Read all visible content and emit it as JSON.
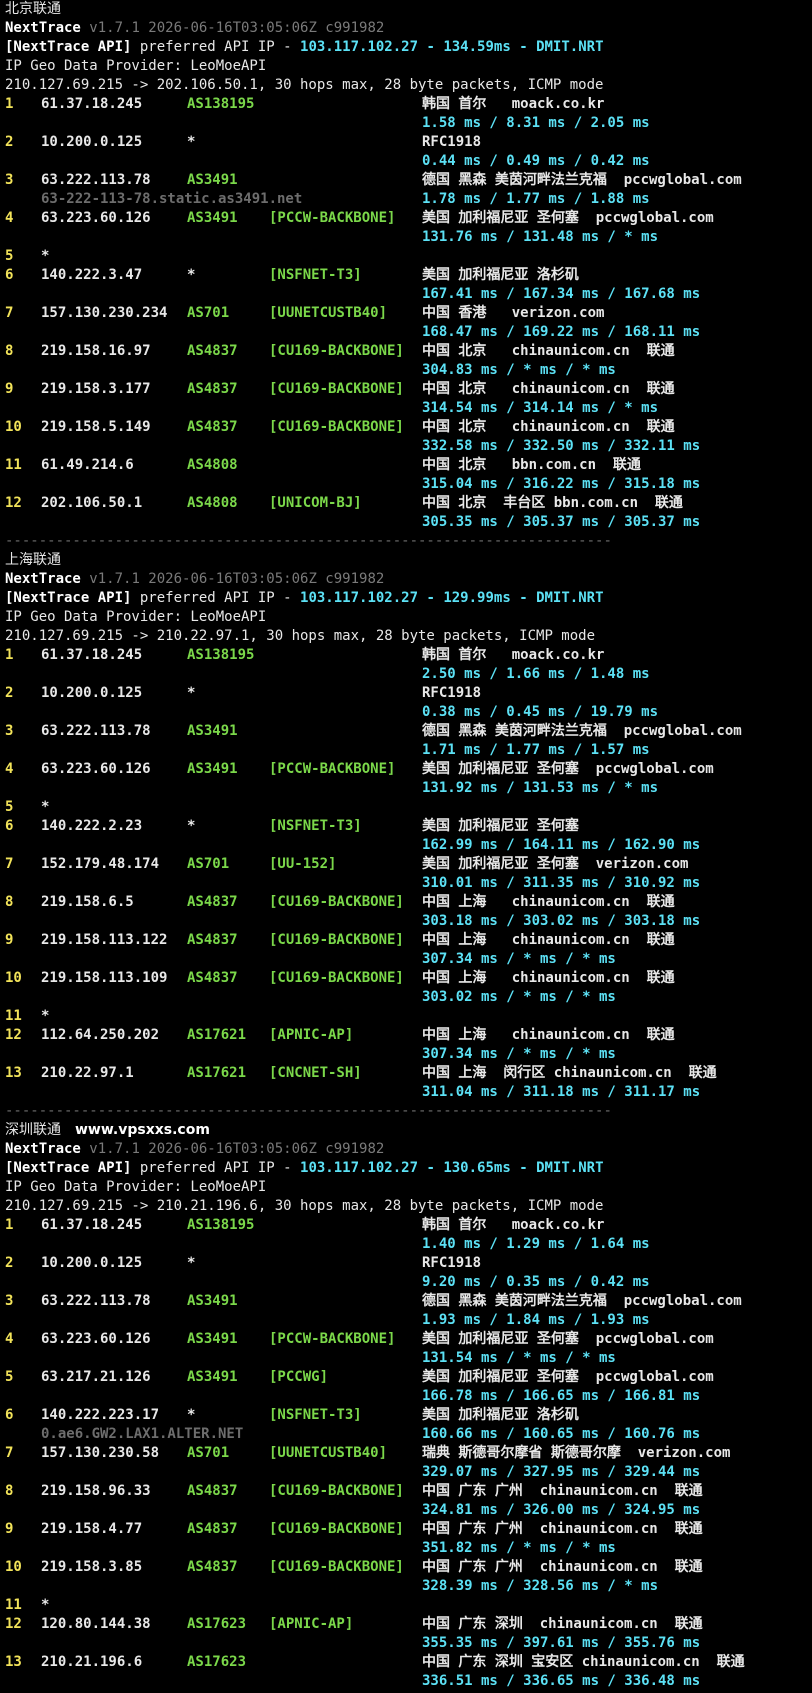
{
  "sections": [
    {
      "title": "北京联通",
      "site": "",
      "product": "NextTrace",
      "version": "v1.7.1 2026-06-16T03:05:06Z c991982",
      "api_prefix": "[NextTrace API]",
      "api_text": " preferred API IP - ",
      "api_ip": "103.117.102.27",
      "api_dash": " - ",
      "api_latency": "134.59ms",
      "api_node": "DMIT.NRT",
      "geo_provider": "IP Geo Data Provider: LeoMoeAPI",
      "trace_line": "210.127.69.215 -> 202.106.50.1, 30 hops max, 28 byte packets, ICMP mode",
      "hops": [
        {
          "n": "1",
          "ip": "61.37.18.245",
          "as": "AS138195",
          "net": "",
          "geo": "韩国 首尔   moack.co.kr",
          "rtt": "1.58 ms / 8.31 ms / 2.05 ms"
        },
        {
          "n": "2",
          "ip": "10.200.0.125",
          "as": "*",
          "net": "",
          "geo": "RFC1918",
          "rtt": "0.44 ms / 0.49 ms / 0.42 ms"
        },
        {
          "n": "3",
          "ip": "63.222.113.78",
          "as": "AS3491",
          "net": "",
          "geo": "德国 黑森 美茵河畔法兰克福  pccwglobal.com",
          "ptr": "63-222-113-78.static.as3491.net",
          "rtt": "1.78 ms / 1.77 ms / 1.88 ms"
        },
        {
          "n": "4",
          "ip": "63.223.60.126",
          "as": "AS3491",
          "net": "[PCCW-BACKBONE]",
          "geo": "美国 加利福尼亚 圣何塞  pccwglobal.com",
          "rtt": "131.76 ms / 131.48 ms / * ms"
        },
        {
          "n": "5",
          "ip": "*"
        },
        {
          "n": "6",
          "ip": "140.222.3.47",
          "as": "*",
          "net": "[NSFNET-T3]",
          "geo": "美国 加利福尼亚 洛杉矶",
          "rtt": "167.41 ms / 167.34 ms / 167.68 ms"
        },
        {
          "n": "7",
          "ip": "157.130.230.234",
          "as": "AS701",
          "net": "[UUNETCUSTB40]",
          "geo": "中国 香港   verizon.com",
          "rtt": "168.47 ms / 169.22 ms / 168.11 ms"
        },
        {
          "n": "8",
          "ip": "219.158.16.97",
          "as": "AS4837",
          "net": "[CU169-BACKBONE]",
          "geo": "中国 北京   chinaunicom.cn  联通",
          "rtt": "304.83 ms / * ms / * ms"
        },
        {
          "n": "9",
          "ip": "219.158.3.177",
          "as": "AS4837",
          "net": "[CU169-BACKBONE]",
          "geo": "中国 北京   chinaunicom.cn  联通",
          "rtt": "314.54 ms / 314.14 ms / * ms"
        },
        {
          "n": "10",
          "ip": "219.158.5.149",
          "as": "AS4837",
          "net": "[CU169-BACKBONE]",
          "geo": "中国 北京   chinaunicom.cn  联通",
          "rtt": "332.58 ms / 332.50 ms / 332.11 ms"
        },
        {
          "n": "11",
          "ip": "61.49.214.6",
          "as": "AS4808",
          "net": "",
          "geo": "中国 北京   bbn.com.cn  联通",
          "rtt": "315.04 ms / 316.22 ms / 315.18 ms"
        },
        {
          "n": "12",
          "ip": "202.106.50.1",
          "as": "AS4808",
          "net": "[UNICOM-BJ]",
          "geo": "中国 北京  丰台区 bbn.com.cn  联通",
          "rtt": "305.35 ms / 305.37 ms / 305.37 ms"
        }
      ]
    },
    {
      "title": "上海联通",
      "site": "",
      "product": "NextTrace",
      "version": "v1.7.1 2026-06-16T03:05:06Z c991982",
      "api_prefix": "[NextTrace API]",
      "api_text": " preferred API IP - ",
      "api_ip": "103.117.102.27",
      "api_dash": " - ",
      "api_latency": "129.99ms",
      "api_node": "DMIT.NRT",
      "geo_provider": "IP Geo Data Provider: LeoMoeAPI",
      "trace_line": "210.127.69.215 -> 210.22.97.1, 30 hops max, 28 byte packets, ICMP mode",
      "hops": [
        {
          "n": "1",
          "ip": "61.37.18.245",
          "as": "AS138195",
          "net": "",
          "geo": "韩国 首尔   moack.co.kr",
          "rtt": "2.50 ms / 1.66 ms / 1.48 ms"
        },
        {
          "n": "2",
          "ip": "10.200.0.125",
          "as": "*",
          "net": "",
          "geo": "RFC1918",
          "rtt": "0.38 ms / 0.45 ms / 19.79 ms"
        },
        {
          "n": "3",
          "ip": "63.222.113.78",
          "as": "AS3491",
          "net": "",
          "geo": "德国 黑森 美茵河畔法兰克福  pccwglobal.com",
          "rtt": "1.71 ms / 1.77 ms / 1.57 ms"
        },
        {
          "n": "4",
          "ip": "63.223.60.126",
          "as": "AS3491",
          "net": "[PCCW-BACKBONE]",
          "geo": "美国 加利福尼亚 圣何塞  pccwglobal.com",
          "rtt": "131.92 ms / 131.53 ms / * ms"
        },
        {
          "n": "5",
          "ip": "*"
        },
        {
          "n": "6",
          "ip": "140.222.2.23",
          "as": "*",
          "net": "[NSFNET-T3]",
          "geo": "美国 加利福尼亚 圣何塞",
          "rtt": "162.99 ms / 164.11 ms / 162.90 ms"
        },
        {
          "n": "7",
          "ip": "152.179.48.174",
          "as": "AS701",
          "net": "[UU-152]",
          "geo": "美国 加利福尼亚 圣何塞  verizon.com",
          "rtt": "310.01 ms / 311.35 ms / 310.92 ms"
        },
        {
          "n": "8",
          "ip": "219.158.6.5",
          "as": "AS4837",
          "net": "[CU169-BACKBONE]",
          "geo": "中国 上海   chinaunicom.cn  联通",
          "rtt": "303.18 ms / 303.02 ms / 303.18 ms"
        },
        {
          "n": "9",
          "ip": "219.158.113.122",
          "as": "AS4837",
          "net": "[CU169-BACKBONE]",
          "geo": "中国 上海   chinaunicom.cn  联通",
          "rtt": "307.34 ms / * ms / * ms"
        },
        {
          "n": "10",
          "ip": "219.158.113.109",
          "as": "AS4837",
          "net": "[CU169-BACKBONE]",
          "geo": "中国 上海   chinaunicom.cn  联通",
          "rtt": "303.02 ms / * ms / * ms"
        },
        {
          "n": "11",
          "ip": "*"
        },
        {
          "n": "12",
          "ip": "112.64.250.202",
          "as": "AS17621",
          "net": "[APNIC-AP]",
          "geo": "中国 上海   chinaunicom.cn  联通",
          "rtt": "307.34 ms / * ms / * ms"
        },
        {
          "n": "13",
          "ip": "210.22.97.1",
          "as": "AS17621",
          "net": "[CNCNET-SH]",
          "geo": "中国 上海  闵行区 chinaunicom.cn  联通",
          "rtt": "311.04 ms / 311.18 ms / 311.17 ms"
        }
      ]
    },
    {
      "title": "深圳联通",
      "site": "www.vpsxxs.com",
      "product": "NextTrace",
      "version": "v1.7.1 2026-06-16T03:05:06Z c991982",
      "api_prefix": "[NextTrace API]",
      "api_text": " preferred API IP - ",
      "api_ip": "103.117.102.27",
      "api_dash": " - ",
      "api_latency": "130.65ms",
      "api_node": "DMIT.NRT",
      "geo_provider": "IP Geo Data Provider: LeoMoeAPI",
      "trace_line": "210.127.69.215 -> 210.21.196.6, 30 hops max, 28 byte packets, ICMP mode",
      "hops": [
        {
          "n": "1",
          "ip": "61.37.18.245",
          "as": "AS138195",
          "net": "",
          "geo": "韩国 首尔   moack.co.kr",
          "rtt": "1.40 ms / 1.29 ms / 1.64 ms"
        },
        {
          "n": "2",
          "ip": "10.200.0.125",
          "as": "*",
          "net": "",
          "geo": "RFC1918",
          "rtt": "9.20 ms / 0.35 ms / 0.42 ms"
        },
        {
          "n": "3",
          "ip": "63.222.113.78",
          "as": "AS3491",
          "net": "",
          "geo": "德国 黑森 美茵河畔法兰克福  pccwglobal.com",
          "rtt": "1.93 ms / 1.84 ms / 1.93 ms"
        },
        {
          "n": "4",
          "ip": "63.223.60.126",
          "as": "AS3491",
          "net": "[PCCW-BACKBONE]",
          "geo": "美国 加利福尼亚 圣何塞  pccwglobal.com",
          "rtt": "131.54 ms / * ms / * ms"
        },
        {
          "n": "5",
          "ip": "63.217.21.126",
          "as": "AS3491",
          "net": "[PCCWG]",
          "geo": "美国 加利福尼亚 圣何塞  pccwglobal.com",
          "rtt": "166.78 ms / 166.65 ms / 166.81 ms"
        },
        {
          "n": "6",
          "ip": "140.222.223.17",
          "as": "*",
          "net": "[NSFNET-T3]",
          "geo": "美国 加利福尼亚 洛杉矶",
          "ptr": "0.ae6.GW2.LAX1.ALTER.NET",
          "rtt": "160.66 ms / 160.65 ms / 160.76 ms"
        },
        {
          "n": "7",
          "ip": "157.130.230.58",
          "as": "AS701",
          "net": "[UUNETCUSTB40]",
          "geo": "瑞典 斯德哥尔摩省 斯德哥尔摩  verizon.com",
          "rtt": "329.07 ms / 327.95 ms / 329.44 ms"
        },
        {
          "n": "8",
          "ip": "219.158.96.33",
          "as": "AS4837",
          "net": "[CU169-BACKBONE]",
          "geo": "中国 广东 广州  chinaunicom.cn  联通",
          "rtt": "324.81 ms / 326.00 ms / 324.95 ms"
        },
        {
          "n": "9",
          "ip": "219.158.4.77",
          "as": "AS4837",
          "net": "[CU169-BACKBONE]",
          "geo": "中国 广东 广州  chinaunicom.cn  联通",
          "rtt": "351.82 ms / * ms / * ms"
        },
        {
          "n": "10",
          "ip": "219.158.3.85",
          "as": "AS4837",
          "net": "[CU169-BACKBONE]",
          "geo": "中国 广东 广州  chinaunicom.cn  联通",
          "rtt": "328.39 ms / 328.56 ms / * ms"
        },
        {
          "n": "11",
          "ip": "*"
        },
        {
          "n": "12",
          "ip": "120.80.144.38",
          "as": "AS17623",
          "net": "[APNIC-AP]",
          "geo": "中国 广东 深圳  chinaunicom.cn  联通",
          "rtt": "355.35 ms / 397.61 ms / 355.76 ms"
        },
        {
          "n": "13",
          "ip": "210.21.196.6",
          "as": "AS17623",
          "net": "",
          "geo": "中国 广东 深圳 宝安区 chinaunicom.cn  联通",
          "rtt": "336.51 ms / 336.65 ms / 336.48 ms"
        }
      ]
    }
  ],
  "separator": "------------------------------------------------------------------------",
  "colors": {
    "background": "#000000",
    "hop_number": "#f2e35a",
    "asn": "#7bd84a",
    "rtt": "#5ce1f5",
    "version": "#7a7a7a"
  }
}
